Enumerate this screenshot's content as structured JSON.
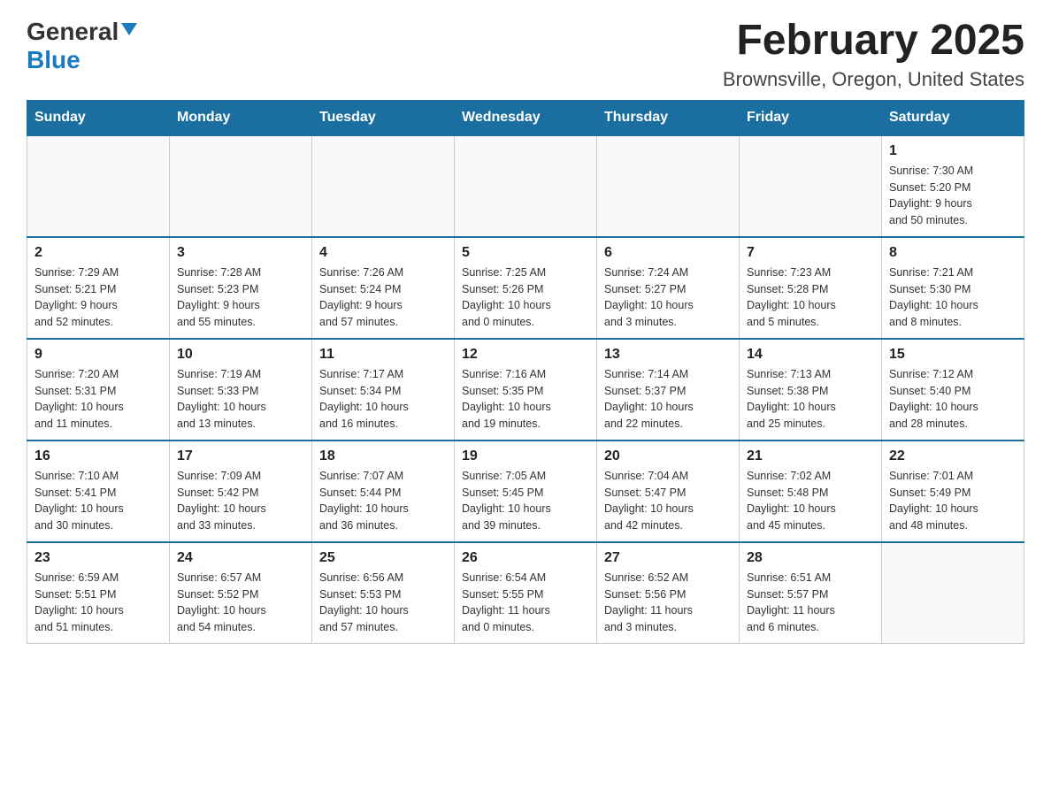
{
  "header": {
    "logo": {
      "general": "General",
      "blue": "Blue",
      "tagline": "GeneralBlue"
    },
    "title": "February 2025",
    "location": "Brownsville, Oregon, United States"
  },
  "days_of_week": [
    "Sunday",
    "Monday",
    "Tuesday",
    "Wednesday",
    "Thursday",
    "Friday",
    "Saturday"
  ],
  "weeks": [
    [
      {
        "day": "",
        "info": ""
      },
      {
        "day": "",
        "info": ""
      },
      {
        "day": "",
        "info": ""
      },
      {
        "day": "",
        "info": ""
      },
      {
        "day": "",
        "info": ""
      },
      {
        "day": "",
        "info": ""
      },
      {
        "day": "1",
        "info": "Sunrise: 7:30 AM\nSunset: 5:20 PM\nDaylight: 9 hours\nand 50 minutes."
      }
    ],
    [
      {
        "day": "2",
        "info": "Sunrise: 7:29 AM\nSunset: 5:21 PM\nDaylight: 9 hours\nand 52 minutes."
      },
      {
        "day": "3",
        "info": "Sunrise: 7:28 AM\nSunset: 5:23 PM\nDaylight: 9 hours\nand 55 minutes."
      },
      {
        "day": "4",
        "info": "Sunrise: 7:26 AM\nSunset: 5:24 PM\nDaylight: 9 hours\nand 57 minutes."
      },
      {
        "day": "5",
        "info": "Sunrise: 7:25 AM\nSunset: 5:26 PM\nDaylight: 10 hours\nand 0 minutes."
      },
      {
        "day": "6",
        "info": "Sunrise: 7:24 AM\nSunset: 5:27 PM\nDaylight: 10 hours\nand 3 minutes."
      },
      {
        "day": "7",
        "info": "Sunrise: 7:23 AM\nSunset: 5:28 PM\nDaylight: 10 hours\nand 5 minutes."
      },
      {
        "day": "8",
        "info": "Sunrise: 7:21 AM\nSunset: 5:30 PM\nDaylight: 10 hours\nand 8 minutes."
      }
    ],
    [
      {
        "day": "9",
        "info": "Sunrise: 7:20 AM\nSunset: 5:31 PM\nDaylight: 10 hours\nand 11 minutes."
      },
      {
        "day": "10",
        "info": "Sunrise: 7:19 AM\nSunset: 5:33 PM\nDaylight: 10 hours\nand 13 minutes."
      },
      {
        "day": "11",
        "info": "Sunrise: 7:17 AM\nSunset: 5:34 PM\nDaylight: 10 hours\nand 16 minutes."
      },
      {
        "day": "12",
        "info": "Sunrise: 7:16 AM\nSunset: 5:35 PM\nDaylight: 10 hours\nand 19 minutes."
      },
      {
        "day": "13",
        "info": "Sunrise: 7:14 AM\nSunset: 5:37 PM\nDaylight: 10 hours\nand 22 minutes."
      },
      {
        "day": "14",
        "info": "Sunrise: 7:13 AM\nSunset: 5:38 PM\nDaylight: 10 hours\nand 25 minutes."
      },
      {
        "day": "15",
        "info": "Sunrise: 7:12 AM\nSunset: 5:40 PM\nDaylight: 10 hours\nand 28 minutes."
      }
    ],
    [
      {
        "day": "16",
        "info": "Sunrise: 7:10 AM\nSunset: 5:41 PM\nDaylight: 10 hours\nand 30 minutes."
      },
      {
        "day": "17",
        "info": "Sunrise: 7:09 AM\nSunset: 5:42 PM\nDaylight: 10 hours\nand 33 minutes."
      },
      {
        "day": "18",
        "info": "Sunrise: 7:07 AM\nSunset: 5:44 PM\nDaylight: 10 hours\nand 36 minutes."
      },
      {
        "day": "19",
        "info": "Sunrise: 7:05 AM\nSunset: 5:45 PM\nDaylight: 10 hours\nand 39 minutes."
      },
      {
        "day": "20",
        "info": "Sunrise: 7:04 AM\nSunset: 5:47 PM\nDaylight: 10 hours\nand 42 minutes."
      },
      {
        "day": "21",
        "info": "Sunrise: 7:02 AM\nSunset: 5:48 PM\nDaylight: 10 hours\nand 45 minutes."
      },
      {
        "day": "22",
        "info": "Sunrise: 7:01 AM\nSunset: 5:49 PM\nDaylight: 10 hours\nand 48 minutes."
      }
    ],
    [
      {
        "day": "23",
        "info": "Sunrise: 6:59 AM\nSunset: 5:51 PM\nDaylight: 10 hours\nand 51 minutes."
      },
      {
        "day": "24",
        "info": "Sunrise: 6:57 AM\nSunset: 5:52 PM\nDaylight: 10 hours\nand 54 minutes."
      },
      {
        "day": "25",
        "info": "Sunrise: 6:56 AM\nSunset: 5:53 PM\nDaylight: 10 hours\nand 57 minutes."
      },
      {
        "day": "26",
        "info": "Sunrise: 6:54 AM\nSunset: 5:55 PM\nDaylight: 11 hours\nand 0 minutes."
      },
      {
        "day": "27",
        "info": "Sunrise: 6:52 AM\nSunset: 5:56 PM\nDaylight: 11 hours\nand 3 minutes."
      },
      {
        "day": "28",
        "info": "Sunrise: 6:51 AM\nSunset: 5:57 PM\nDaylight: 11 hours\nand 6 minutes."
      },
      {
        "day": "",
        "info": ""
      }
    ]
  ]
}
